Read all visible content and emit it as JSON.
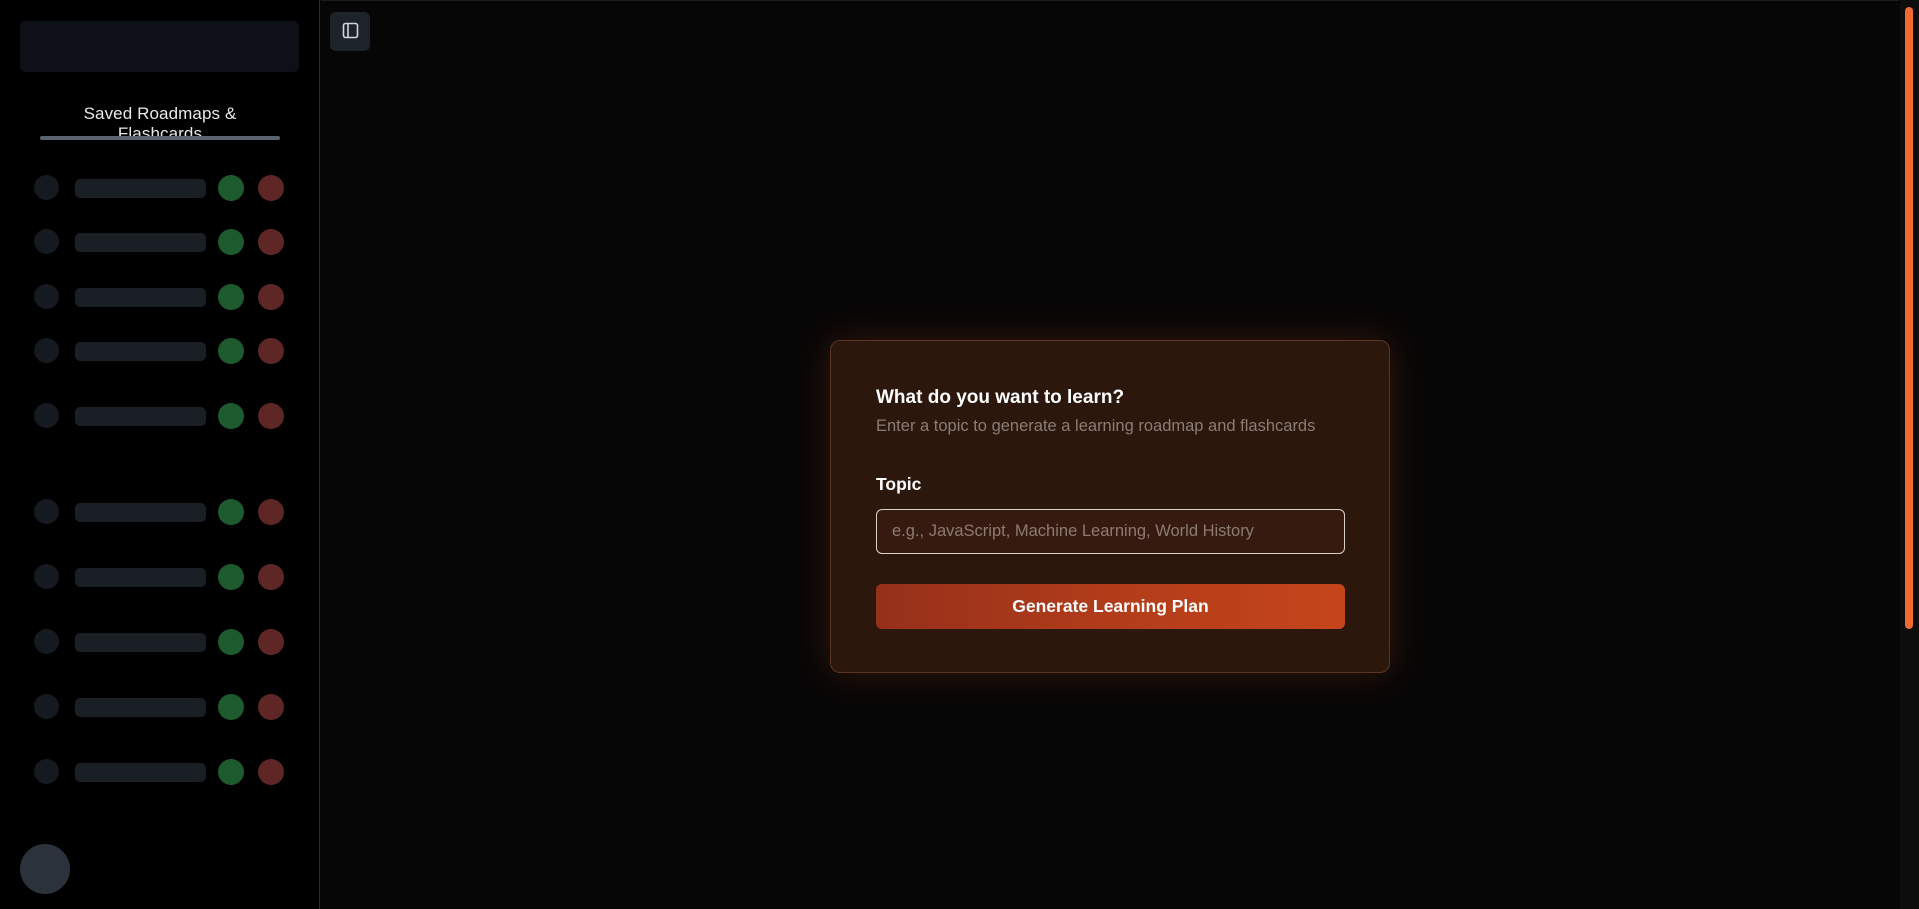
{
  "sidebar": {
    "heading": "Saved Roadmaps & Flashcards",
    "items": [
      {
        "label": ""
      },
      {
        "label": ""
      },
      {
        "label": ""
      },
      {
        "label": ""
      },
      {
        "label": ""
      },
      {
        "label": ""
      },
      {
        "label": ""
      },
      {
        "label": ""
      },
      {
        "label": ""
      },
      {
        "label": ""
      }
    ]
  },
  "toolbar": {
    "toggle_icon": "sidebar-toggle-icon"
  },
  "form": {
    "title": "What do you want to learn?",
    "subtitle": "Enter a topic to generate a learning roadmap and flashcards",
    "topic_label": "Topic",
    "topic_value": "",
    "topic_placeholder": "e.g., JavaScript, Machine Learning, World History",
    "generate_label": "Generate Learning Plan"
  },
  "colors": {
    "accent": "#ef6b33",
    "button": "#b43d1a",
    "card_bg": "#2c170d",
    "success_dot": "#1d5a2e",
    "danger_dot": "#5e2625"
  }
}
